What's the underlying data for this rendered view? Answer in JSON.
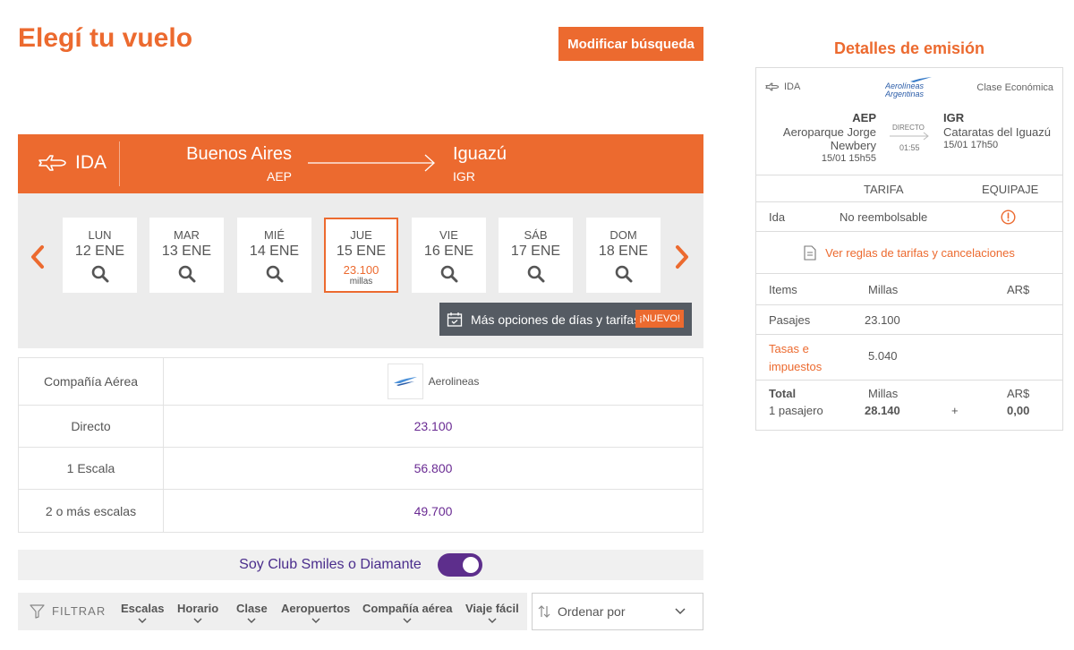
{
  "header": {
    "title": "Elegí tu vuelo",
    "modify_label": "Modificar búsqueda"
  },
  "route": {
    "direction": "IDA",
    "from_city": "Buenos Aires",
    "from_code": "AEP",
    "to_city": "Iguazú",
    "to_code": "IGR"
  },
  "dates": [
    {
      "dow": "LUN",
      "date": "12 ENE"
    },
    {
      "dow": "MAR",
      "date": "13 ENE"
    },
    {
      "dow": "MIÉ",
      "date": "14 ENE"
    },
    {
      "dow": "JUE",
      "date": "15 ENE",
      "selected": true,
      "price": "23.100",
      "unit": "millas"
    },
    {
      "dow": "VIE",
      "date": "16 ENE"
    },
    {
      "dow": "SÁB",
      "date": "17 ENE"
    },
    {
      "dow": "DOM",
      "date": "18 ENE"
    }
  ],
  "more_options": {
    "label": "Más opciones de días y tarifas",
    "badge": "¡NUEVO!"
  },
  "matrix": {
    "airline_label": "Compañía Aérea",
    "airline_name": "Aerolineas",
    "rows": [
      {
        "label": "Directo",
        "value": "23.100"
      },
      {
        "label": "1 Escala",
        "value": "56.800"
      },
      {
        "label": "2 o más escalas",
        "value": "49.700"
      }
    ]
  },
  "club": {
    "label": "Soy Club Smiles o Diamante",
    "toggle_on": true
  },
  "filters": {
    "label": "FILTRAR",
    "items": [
      "Escalas",
      "Horario",
      "Clase",
      "Aeropuertos",
      "Compañía aérea",
      "Viaje fácil"
    ],
    "sort_label": "Ordenar por"
  },
  "details": {
    "title": "Detalles de emisión",
    "direction": "IDA",
    "airline_logo_text": [
      "Aerolíneas",
      "Argentinas"
    ],
    "class": "Clase Económica",
    "from_code": "AEP",
    "from_name": "Aeroparque Jorge Newbery",
    "from_datetime": "15/01 15h55",
    "stop_type": "DIRECTO",
    "duration": "01:55",
    "to_code": "IGR",
    "to_name": "Cataratas del Iguazú",
    "to_datetime": "15/01 17h50",
    "fare_header": "TARIFA",
    "baggage_header": "EQUIPAJE",
    "fare_row_label": "Ida",
    "fare_row_value": "No reembolsable",
    "rules_link": "Ver reglas de tarifas y cancelaciones",
    "items_header": "Items",
    "miles_header": "Millas",
    "currency_header": "AR$",
    "pasajes_label": "Pasajes",
    "pasajes_miles": "23.100",
    "tasas_label": "Tasas e impuestos",
    "tasas_miles": "5.040",
    "total_label": "Total",
    "passengers": "1 pasajero",
    "total_miles_header": "Millas",
    "total_miles": "28.140",
    "plus": "+",
    "total_currency_header": "AR$",
    "total_currency": "0,00"
  },
  "colors": {
    "accent": "#ec6a2f",
    "purple": "#6a2b93",
    "dark_banner": "#555b63"
  }
}
